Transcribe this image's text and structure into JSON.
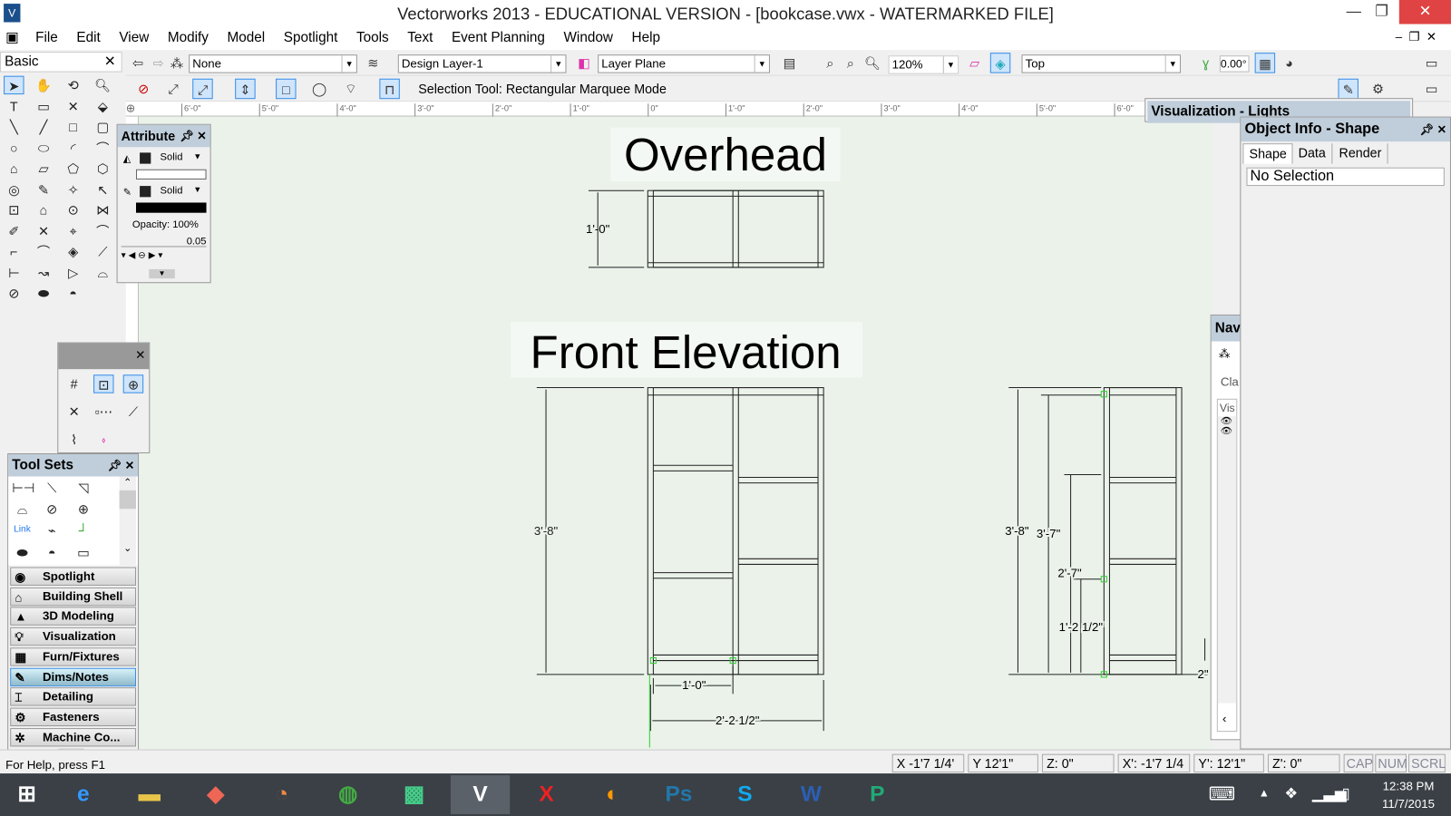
{
  "window": {
    "title": "Vectorworks 2013 - EDUCATIONAL VERSION - [bookcase.vwx - WATERMARKED FILE]"
  },
  "menu": [
    "File",
    "Edit",
    "View",
    "Modify",
    "Model",
    "Spotlight",
    "Tools",
    "Text",
    "Event Planning",
    "Window",
    "Help"
  ],
  "view_bar": {
    "class": "None",
    "layer": "Design Layer-1",
    "plane": "Layer Plane",
    "zoom": "120%",
    "view": "Top",
    "angle": "0.00°"
  },
  "mode_bar": {
    "hint": "Selection Tool: Rectangular Marquee Mode"
  },
  "ruler": [
    "6'-0\"",
    "5'-0\"",
    "4'-0\"",
    "3'-0\"",
    "2'-0\"",
    "1'-0\"",
    "0\"",
    "1'-0\"",
    "2'-0\"",
    "3'-0\"",
    "4'-0\"",
    "5'-0\"",
    "6'-0\""
  ],
  "basic_palette": {
    "title": "Basic"
  },
  "attributes": {
    "title": "Attribute",
    "fill": "Solid",
    "pen": "Solid",
    "opacity": "Opacity: 100%",
    "line_weight": "0.05"
  },
  "tool_sets": {
    "title": "Tool Sets",
    "items": [
      {
        "label": "Spotlight",
        "icon": "spotlight-icon"
      },
      {
        "label": "Building Shell",
        "icon": "house-icon"
      },
      {
        "label": "3D Modeling",
        "icon": "shapes-icon"
      },
      {
        "label": "Visualization",
        "icon": "bulb-icon"
      },
      {
        "label": "Furn/Fixtures",
        "icon": "furniture-icon"
      },
      {
        "label": "Dims/Notes",
        "icon": "pencil-icon",
        "active": true
      },
      {
        "label": "Detailing",
        "icon": "beam-icon"
      },
      {
        "label": "Fasteners",
        "icon": "bolt-icon"
      },
      {
        "label": "Machine Co...",
        "icon": "gear-icon"
      }
    ],
    "link_label": "Link"
  },
  "drawing": {
    "overhead_title": "Overhead",
    "front_title": "Front Elevation",
    "dims": {
      "overhead_depth": "1'-0\"",
      "front_height": "3'-8\"",
      "front_bay": "1'-0\"",
      "front_width": "2'-2 1/2\"",
      "side_h1": "3'-8\"",
      "side_h2": "3'-7\"",
      "side_h3": "2'-7\"",
      "side_h4": "1'-2 1/2\"",
      "side_h5": "2\""
    }
  },
  "vis_palette": {
    "title": "Visualization - Lights"
  },
  "obj_info": {
    "title": "Object Info - Shape",
    "tabs": [
      "Shape",
      "Data",
      "Render"
    ],
    "value": "No Selection"
  },
  "nav_palette": {
    "title": "Nav",
    "class_label": "Cla",
    "vis_label": "Vis"
  },
  "status": {
    "help": "For Help, press F1",
    "x": "X -1'7 1/4'",
    "y": "Y 12'1\"",
    "z": "Z: 0\"",
    "xp": "X': -1'7 1/4",
    "yp": "Y': 12'1\"",
    "zp": "Z': 0\"",
    "cap": "CAP",
    "num": "NUM",
    "scrl": "SCRL"
  },
  "taskbar": {
    "time": "12:38 PM",
    "date": "11/7/2015",
    "apps": [
      "IE",
      "Files",
      "Office",
      "Firefox",
      "Chrome",
      "App",
      "Vectorworks",
      "Acrobat",
      "Vault",
      "Photoshop",
      "Skype",
      "Word",
      "Project"
    ]
  },
  "colors": {
    "canvas": "#eaf2ea",
    "palette_header": "#c0cedb",
    "selection": "#3a8ee6",
    "taskbar": "#3a4046"
  }
}
